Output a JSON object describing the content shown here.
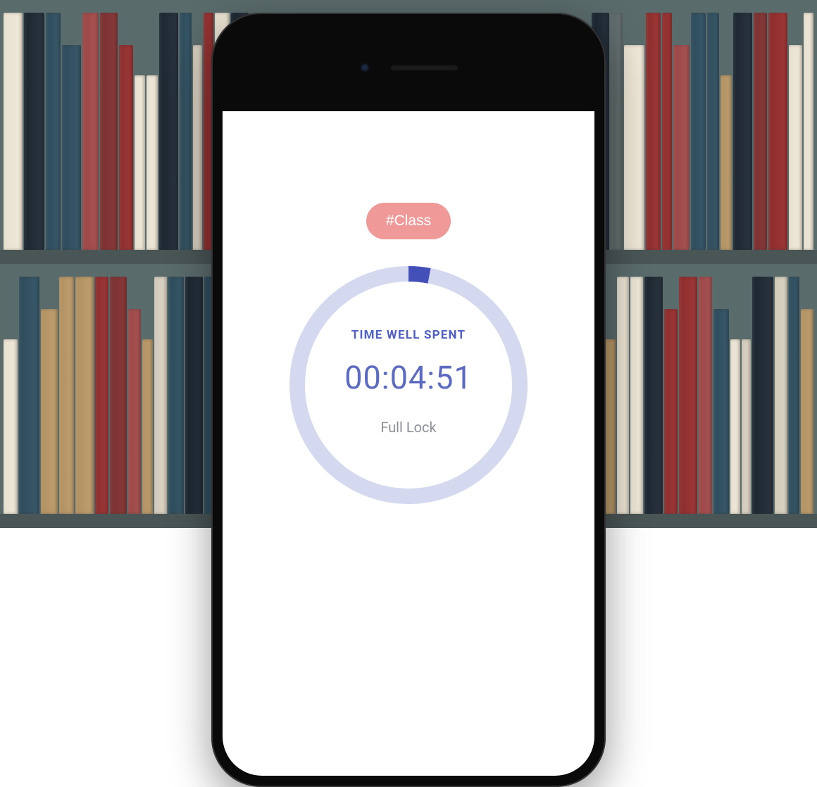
{
  "tag": {
    "label": "#Class"
  },
  "timer": {
    "heading": "TIME WELL SPENT",
    "value": "00:04:51",
    "mode": "Full Lock",
    "progress_percent": 3
  },
  "colors": {
    "pill_bg": "#f09999",
    "ring_bg": "#d4d9f0",
    "ring_fg": "#4250b8",
    "accent_text": "#5c6bc0"
  }
}
